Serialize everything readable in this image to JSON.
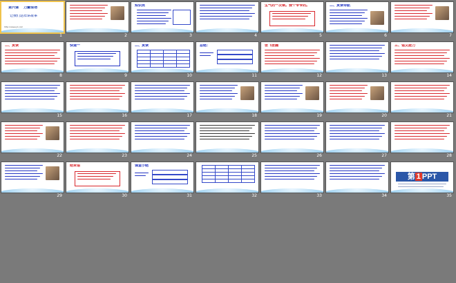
{
  "slides": [
    {
      "n": "1",
      "kind": "title",
      "h1": "第六课",
      "h2": "力量现场",
      "sub": "让我们这样讲故事",
      "foot": "http://www.jd.com"
    },
    {
      "n": "2",
      "kind": "text-pic",
      "color": "#d8262b"
    },
    {
      "n": "3",
      "kind": "bullets",
      "h1": "知识点",
      "color": "#2334c3"
    },
    {
      "n": "4",
      "kind": "text",
      "color": "#2334c3"
    },
    {
      "n": "5",
      "kind": "callout",
      "h1": "生气的一次乘。",
      "h2": "我个爷爷的。",
      "color": "#d8262b"
    },
    {
      "n": "6",
      "kind": "text-pic",
      "h1": "二、赏读导航",
      "color": "#2334c3"
    },
    {
      "n": "7",
      "kind": "text-pic",
      "color": "#d8262b"
    },
    {
      "n": "8",
      "kind": "text",
      "h1": "二、赏读",
      "color": "#d8262b"
    },
    {
      "n": "9",
      "kind": "callout",
      "h1": "快速一",
      "color": "#2334c3"
    },
    {
      "n": "10",
      "kind": "table",
      "h1": "二、赏读",
      "color": "#2334c3"
    },
    {
      "n": "11",
      "kind": "boxes",
      "h1": "总结：",
      "color": "#2334c3"
    },
    {
      "n": "12",
      "kind": "text",
      "h1": "张飞张巍",
      "color": "#d8262b"
    },
    {
      "n": "13",
      "kind": "text",
      "color": "#2334c3"
    },
    {
      "n": "14",
      "kind": "text",
      "h1": "三、语文能力",
      "color": "#d8262b"
    },
    {
      "n": "15",
      "kind": "text",
      "color": "#2334c3"
    },
    {
      "n": "16",
      "kind": "text",
      "color": "#d8262b"
    },
    {
      "n": "17",
      "kind": "text",
      "color": "#2334c3"
    },
    {
      "n": "18",
      "kind": "text-pic",
      "color": "#2334c3"
    },
    {
      "n": "19",
      "kind": "text-pic",
      "color": "#2334c3"
    },
    {
      "n": "20",
      "kind": "text-pic",
      "color": "#d8262b"
    },
    {
      "n": "21",
      "kind": "text",
      "color": "#d8262b"
    },
    {
      "n": "22",
      "kind": "text-pic",
      "color": "#d8262b"
    },
    {
      "n": "23",
      "kind": "text",
      "color": "#d8262b"
    },
    {
      "n": "24",
      "kind": "text",
      "color": "#2334c3"
    },
    {
      "n": "25",
      "kind": "text",
      "color": "#333333"
    },
    {
      "n": "26",
      "kind": "text",
      "color": "#2334c3"
    },
    {
      "n": "27",
      "kind": "text",
      "color": "#2334c3"
    },
    {
      "n": "28",
      "kind": "text",
      "color": "#d8262b"
    },
    {
      "n": "29",
      "kind": "text-pic",
      "color": "#2334c3"
    },
    {
      "n": "30",
      "kind": "callout",
      "h1": "结束语",
      "color": "#d8262b"
    },
    {
      "n": "31",
      "kind": "boxes",
      "h1": "课堂小结",
      "color": "#2334c3"
    },
    {
      "n": "32",
      "kind": "table",
      "color": "#2334c3"
    },
    {
      "n": "33",
      "kind": "text",
      "color": "#2334c3"
    },
    {
      "n": "34",
      "kind": "text",
      "color": "#2334c3"
    },
    {
      "n": "35",
      "kind": "logo",
      "logo_a": "第",
      "logo_b": "1",
      "logo_c": "PPT",
      "color": "#2b57a8"
    }
  ],
  "selected": "1"
}
